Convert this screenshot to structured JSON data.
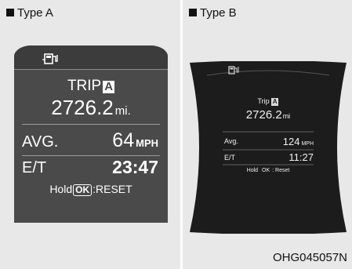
{
  "type_a": {
    "label": "Type A",
    "trip_label": "TRIP",
    "trip_badge": "A",
    "distance_value": "2726.2",
    "distance_unit": "mi.",
    "avg_label": "AVG.",
    "avg_value": "64",
    "avg_unit": "MPH",
    "et_label": "E/T",
    "et_value": "23:47",
    "hold_label": "Hold",
    "ok_label": "OK",
    "reset_label": ":RESET"
  },
  "type_b": {
    "label": "Type B",
    "trip_label": "Trip",
    "trip_badge": "A",
    "distance_value": "2726.2",
    "distance_unit": "mi",
    "avg_label": "Avg.",
    "avg_value": "124",
    "avg_unit": "MPH",
    "et_label": "E/T",
    "et_value": "11:27",
    "hold_label": "Hold",
    "ok_label": "OK",
    "reset_label": ": Reset"
  },
  "figure_code": "OHG045057N",
  "icons": [
    "fuel-pump-icon"
  ],
  "colors": {
    "screen_a": "#4a4a4a",
    "screen_b": "#1c1c1c",
    "panel_bg": "#e8e8e8"
  }
}
